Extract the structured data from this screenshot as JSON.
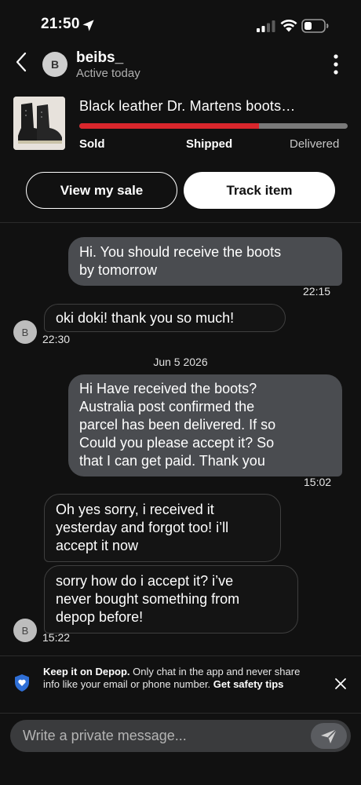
{
  "status_bar": {
    "time": "21:50"
  },
  "header": {
    "avatar_initial": "B",
    "username": "beibs_",
    "presence": "Active today"
  },
  "product": {
    "title": "Black leather Dr. Martens boots…",
    "progress": 0.67,
    "stages": [
      "Sold",
      "Shipped",
      "Delivered"
    ],
    "colors": {
      "progress": "#d9262c",
      "track": "#7a7a7a"
    }
  },
  "actions": {
    "view_sale": "View my sale",
    "track_item": "Track item"
  },
  "messages": {
    "m1": {
      "lines": [
        "Hi. You should receive the boots",
        "by tomorrow"
      ],
      "time": "22:15"
    },
    "m2": {
      "text": "oki doki! thank you so much!",
      "time": "22:30",
      "avatar": "B"
    },
    "date_separator": "Jun 5 2026",
    "m3": {
      "lines": [
        "Hi Have received the boots?",
        "Australia post confirmed the",
        "parcel has been delivered.  If so",
        "Could you please accept it?  So",
        "that I can get paid.  Thank you"
      ],
      "time": "15:02"
    },
    "m4": {
      "lines": [
        "Oh yes sorry, i received it",
        "yesterday and forgot too! i’ll",
        "accept it now"
      ]
    },
    "m5": {
      "lines": [
        "sorry how do i accept it? i’ve",
        "never bought something from",
        "depop before!"
      ],
      "time": "15:22",
      "avatar": "B"
    }
  },
  "safety": {
    "bold1": "Keep it on Depop.",
    "text1": " Only chat in the app and never share info like your email or phone number. ",
    "bold2": "Get safety tips"
  },
  "composer": {
    "placeholder": "Write a private message..."
  },
  "icons": [
    "location-arrow-icon",
    "signal-icon",
    "wifi-icon",
    "battery-icon",
    "back-chevron-icon",
    "more-vertical-icon",
    "shield-heart-icon",
    "close-icon",
    "send-icon"
  ]
}
